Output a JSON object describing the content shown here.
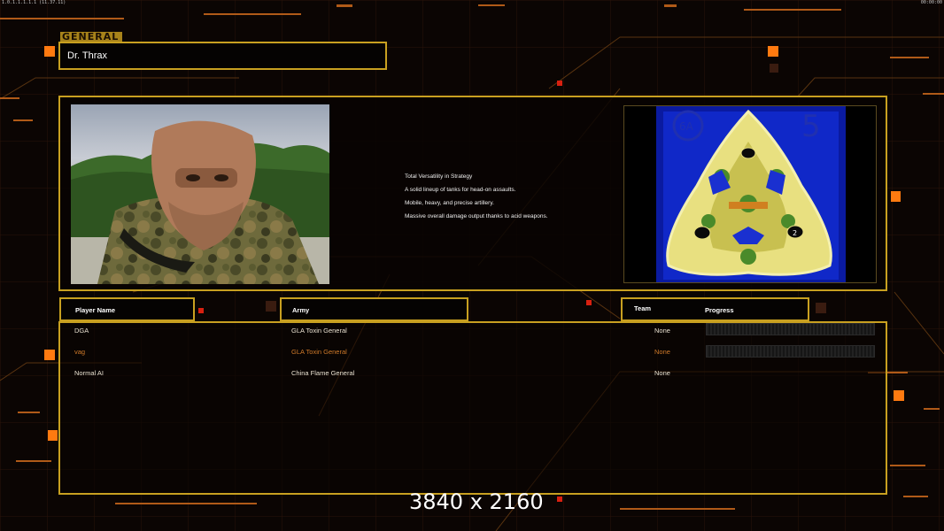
{
  "top_bar": {
    "left_text": "1.0.1.1.1.1.1 (11.37.11)",
    "right_text": "00:00:00"
  },
  "general": {
    "section_label": "GENERAL",
    "name": "Dr. Thrax",
    "portrait_icon": "masked-soldier-portrait",
    "description": [
      "Total Versatility in Strategy",
      "A solid lineup of tanks for head-on assaults.",
      "Mobile, heavy, and precise artillery.",
      "Massive overall damage output thanks to acid weapons."
    ]
  },
  "map": {
    "preview_icon": "tri-island-map-preview",
    "slot_labels": [
      "6A",
      "5",
      "2"
    ]
  },
  "table": {
    "headers": {
      "player": "Player Name",
      "army": "Army",
      "team": "Team",
      "progress": "Progress"
    },
    "rows": [
      {
        "player": "DGA",
        "army": "GLA Toxin General",
        "team": "None",
        "has_progress": true,
        "progress": 0,
        "color": "#e8e0d0"
      },
      {
        "player": "vag",
        "army": "GLA Toxin General",
        "team": "None",
        "has_progress": true,
        "progress": 0,
        "color": "#d07a2a"
      },
      {
        "player": "Normal AI",
        "army": "China Flame General",
        "team": "None",
        "has_progress": false,
        "color": "#e8e0d0"
      }
    ]
  },
  "overlay": {
    "resolution": "3840 x 2160"
  },
  "colors": {
    "frame": "#c8a020",
    "accent_orange": "#ff7a10",
    "local_player": "#d07a2a"
  }
}
